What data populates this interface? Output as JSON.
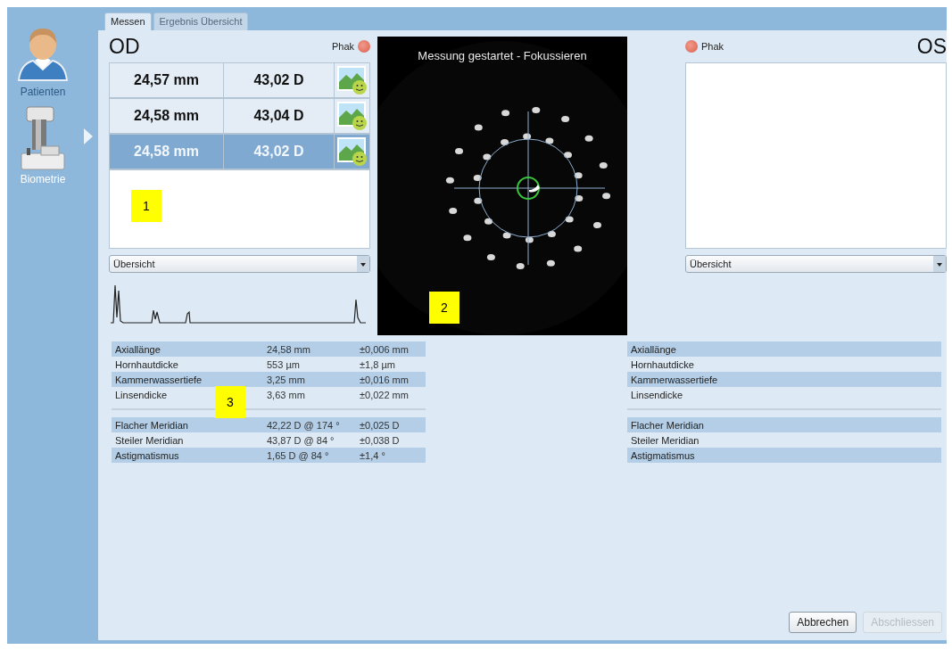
{
  "sidebar": {
    "items": [
      {
        "label": "Patienten",
        "kind": "person",
        "selected": false
      },
      {
        "label": "Biometrie",
        "kind": "device",
        "selected": true
      }
    ]
  },
  "tabs": [
    {
      "label": "Messen",
      "selected": true
    },
    {
      "label": "Ergebnis Übersicht",
      "selected": false
    }
  ],
  "eyes": [
    {
      "title": "OD",
      "indicator": "Phak",
      "marker": "1",
      "measurements": [
        {
          "axial_length": "24,57 mm",
          "keratometry": "43,02 D",
          "selected": false
        },
        {
          "axial_length": "24,58 mm",
          "keratometry": "43,04 D",
          "selected": false
        },
        {
          "axial_length": "24,58 mm",
          "keratometry": "43,02 D",
          "selected": true
        }
      ],
      "view": "Übersicht",
      "waveform": true
    },
    {
      "title": "OS",
      "indicator": "Phak",
      "view": "Übersicht"
    }
  ],
  "camera": {
    "status": "Messung gestartet - Fokussieren",
    "marker": "2"
  },
  "results": [
    {
      "marker": "3",
      "groups": [
        {
          "rows": [
            {
              "label": "Axiallänge",
              "value": "24,58 mm",
              "tolerance": "±0,006 mm"
            },
            {
              "label": "Hornhautdicke",
              "value": "553 µm",
              "tolerance": "±1,8 µm"
            },
            {
              "label": "Kammerwassertiefe",
              "value": "3,25 mm",
              "tolerance": "±0,016 mm"
            },
            {
              "label": "Linsendicke",
              "value": "3,63 mm",
              "tolerance": "±0,022 mm"
            }
          ]
        },
        {
          "rows": [
            {
              "label": "Flacher Meridian",
              "value": "42,22 D @ 174 °",
              "tolerance": "±0,025 D"
            },
            {
              "label": "Steiler Meridian",
              "value": "43,87 D @ 84 °",
              "tolerance": "±0,038 D"
            },
            {
              "label": "Astigmatismus",
              "value": "1,65 D @ 84 °",
              "tolerance": "±1,4 °"
            }
          ]
        }
      ]
    },
    {
      "groups": [
        {
          "rows": [
            {
              "label": "Axiallänge"
            },
            {
              "label": "Hornhautdicke"
            },
            {
              "label": "Kammerwassertiefe"
            },
            {
              "label": "Linsendicke"
            }
          ]
        },
        {
          "rows": [
            {
              "label": "Flacher Meridian"
            },
            {
              "label": "Steiler Meridian"
            },
            {
              "label": "Astigmatismus"
            }
          ]
        }
      ]
    }
  ],
  "buttons": [
    {
      "label": "Abbrechen",
      "disabled": false
    },
    {
      "label": "Abschliessen",
      "disabled": true
    }
  ]
}
